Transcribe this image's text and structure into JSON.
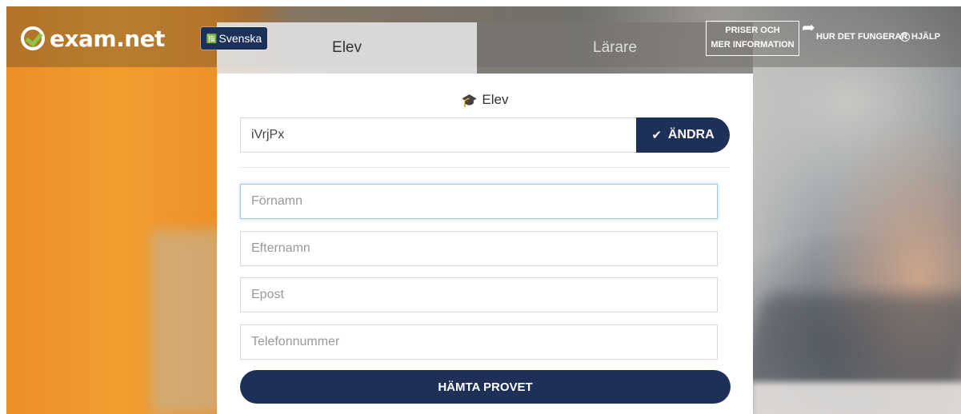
{
  "brand": {
    "logo_text": "exam.net",
    "logo_accent": "#8cc63e"
  },
  "header": {
    "language_label": "Svenska",
    "tabs": [
      {
        "label": "Elev"
      },
      {
        "label": "Lärare"
      }
    ],
    "pricing_line1": "PRISER OCH",
    "pricing_line2": "MER INFORMATION",
    "how_it_works": "HUR DET FUNGERAR",
    "help": "HJÄLP",
    "help_icon": "?"
  },
  "form": {
    "title": "Elev",
    "exam_key_value": "iVrjPx",
    "change_button": "ÄNDRA",
    "fields": [
      {
        "placeholder": "Förnamn"
      },
      {
        "placeholder": "Efternamn"
      },
      {
        "placeholder": "Epost"
      },
      {
        "placeholder": "Telefonnummer"
      }
    ],
    "submit_label": "HÄMTA PROVET"
  },
  "colors": {
    "primary": "#1f3058",
    "language_badge": "#1c3159",
    "focus_border": "#9ecaed"
  }
}
